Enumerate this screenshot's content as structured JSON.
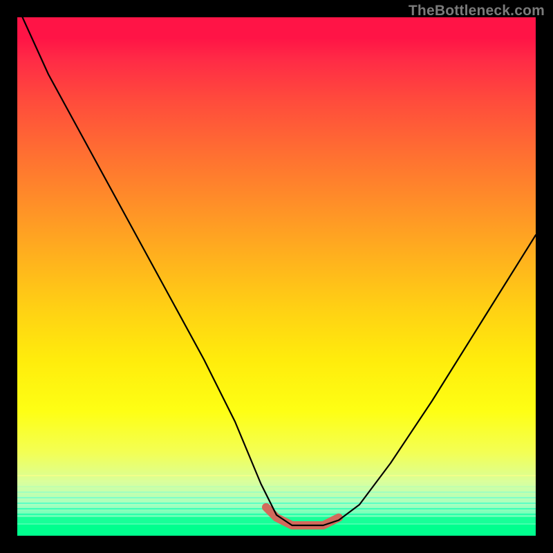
{
  "watermark": "TheBottleneck.com",
  "colors": {
    "page_bg": "#000000",
    "curve_stroke": "#000000",
    "marker_stroke": "#d26a5c",
    "gradient_top": "#ff1446",
    "gradient_bottom": "#00ff8e",
    "watermark_text": "#7a7a7a"
  },
  "chart_data": {
    "type": "line",
    "title": "",
    "xlabel": "",
    "ylabel": "",
    "xlim": [
      0,
      100
    ],
    "ylim": [
      0,
      100
    ],
    "grid": false,
    "series": [
      {
        "name": "bottleneck-curve",
        "x": [
          1,
          6,
          12,
          18,
          24,
          30,
          36,
          42,
          47,
          50,
          53,
          56,
          59,
          62,
          66,
          72,
          80,
          90,
          100
        ],
        "y": [
          100,
          89,
          78,
          67,
          56,
          45,
          34,
          22,
          10,
          4,
          2,
          2,
          2,
          3,
          6,
          14,
          26,
          42,
          58
        ]
      }
    ],
    "highlight": {
      "name": "sweet-spot-marker",
      "x": [
        48,
        50,
        53,
        56,
        59,
        62
      ],
      "y": [
        5.5,
        3.5,
        2,
        2,
        2,
        3.5
      ]
    },
    "background": {
      "style": "vertical-gradient",
      "stops": [
        {
          "pos": 0.0,
          "color": "#ff1446"
        },
        {
          "pos": 0.5,
          "color": "#ffb01e"
        },
        {
          "pos": 0.78,
          "color": "#feff14"
        },
        {
          "pos": 1.0,
          "color": "#00ff8e"
        }
      ]
    }
  }
}
